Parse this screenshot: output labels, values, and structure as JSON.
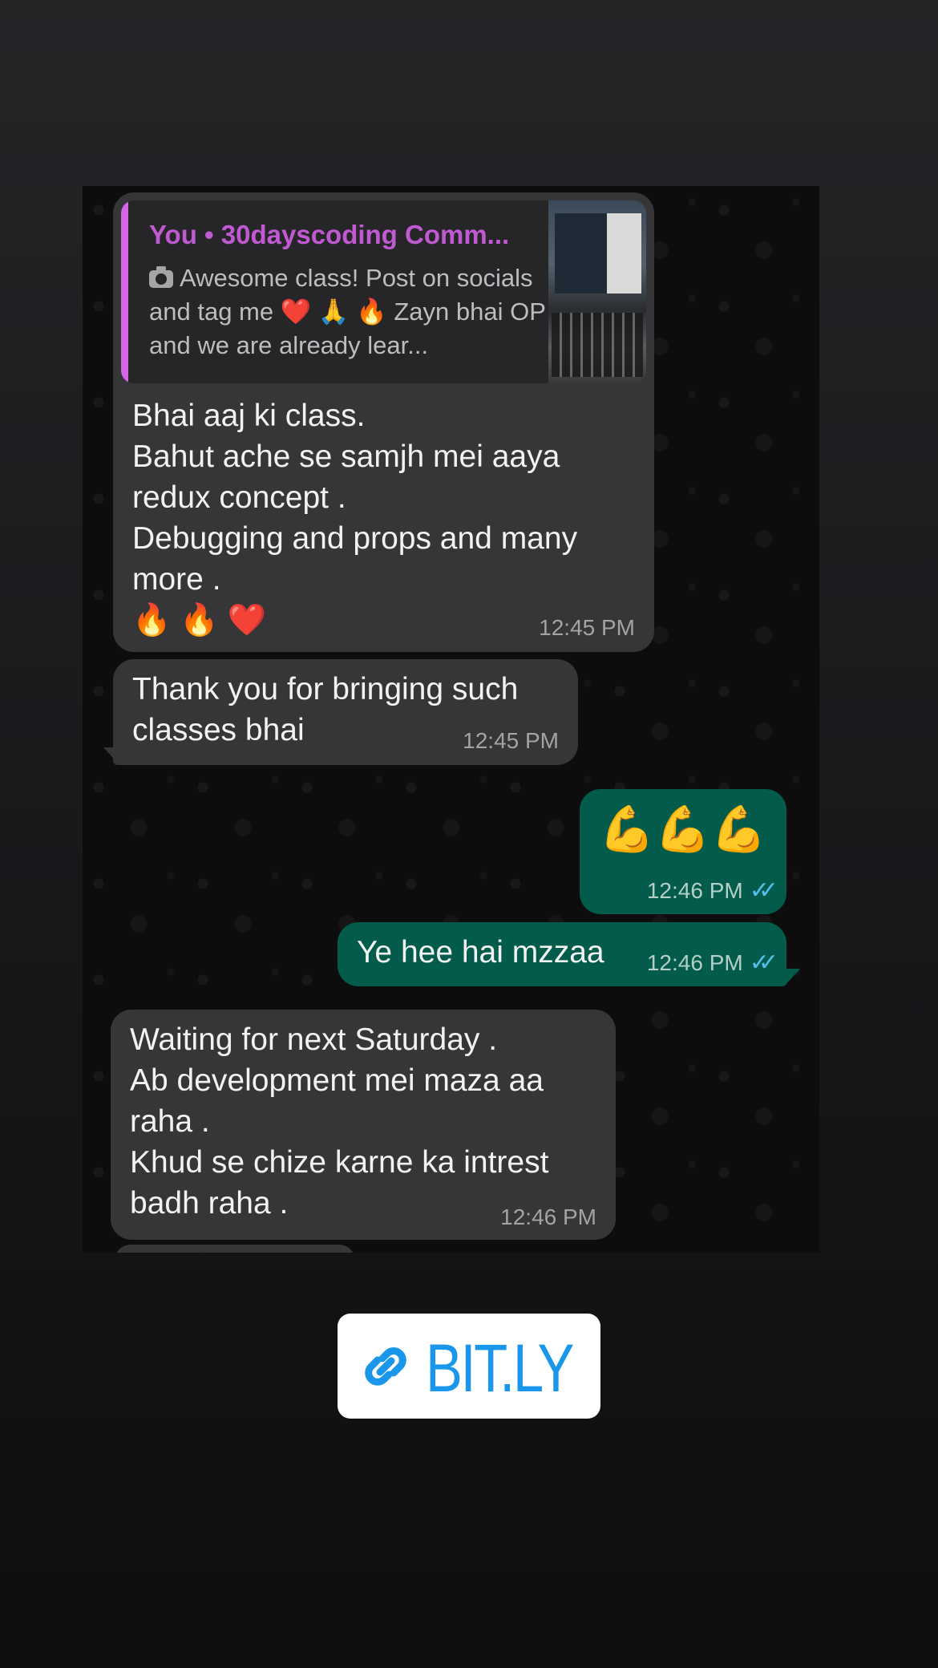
{
  "chat": {
    "messages": [
      {
        "id": "m1",
        "direction": "incoming",
        "quote": {
          "title": "You • 30dayscoding Comm...",
          "icon": "camera-icon",
          "text": "Awesome class! Post on socials and tag me ❤️ 🙏 🔥  Zayn bhai OP and we are already lear..."
        },
        "text": "Bhai aaj ki class.\nBahut ache se samjh mei aaya\nredux concept .\nDebugging and props and many\nmore .\n🔥 🔥 ❤️",
        "time": "12:45 PM"
      },
      {
        "id": "m2",
        "direction": "incoming",
        "text": "Thank you for bringing such\nclasses bhai",
        "time": "12:45 PM"
      },
      {
        "id": "m3",
        "direction": "outgoing",
        "text": "💪💪💪",
        "time": "12:46 PM",
        "status": "read"
      },
      {
        "id": "m4",
        "direction": "outgoing",
        "text": "Ye hee hai mzzaa",
        "time": "12:46 PM",
        "status": "read"
      },
      {
        "id": "m5",
        "direction": "incoming",
        "text": "Waiting for next Saturday .\nAb development mei maza aa\nraha .\nKhud se chize karne ka intrest\nbadh raha .",
        "time": "12:46 PM"
      }
    ]
  },
  "link_sticker": {
    "icon": "link-icon",
    "label": "BIT.LY"
  },
  "colors": {
    "incoming_bubble": "#363638",
    "outgoing_bubble": "#035c4b",
    "quote_accent": "#d765e6",
    "read_ticks": "#53bdeb",
    "link_blue": "#1a96ea"
  }
}
